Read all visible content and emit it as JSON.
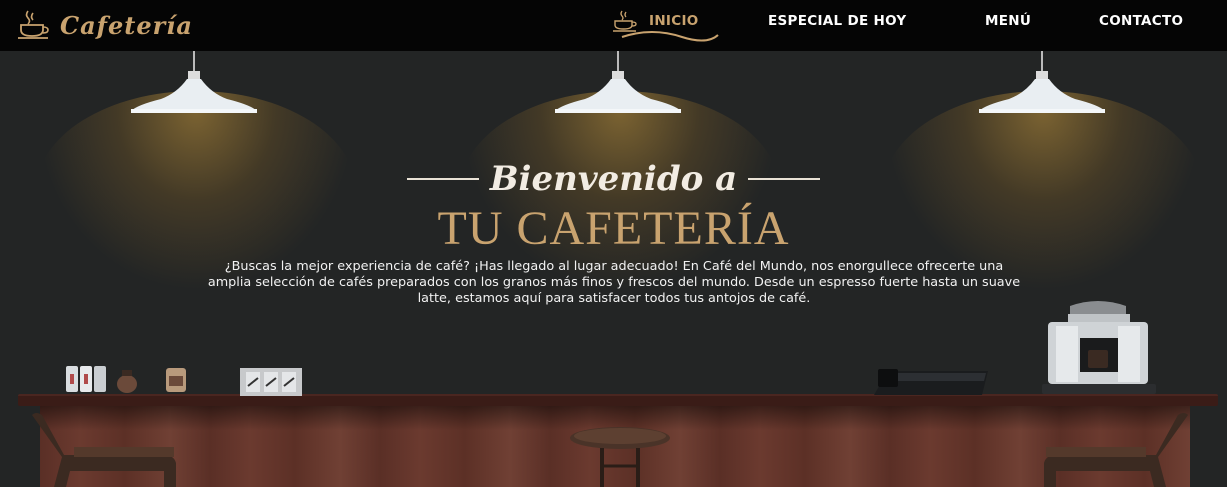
{
  "brand": {
    "name": "Cafetería",
    "icon": "coffee-cup-icon"
  },
  "nav": {
    "items": [
      {
        "label": "INICIO",
        "icon": "coffee-cup-icon",
        "active": true
      },
      {
        "label": "ESPECIAL DE HOY",
        "active": false
      },
      {
        "label": "MENÚ",
        "active": false
      },
      {
        "label": "CONTACTO",
        "active": false
      }
    ]
  },
  "hero": {
    "welcome": "Bienvenido a",
    "title": "TU CAFETERÍA",
    "description": "¿Buscas la mejor experiencia de café? ¡Has llegado al lugar adecuado! En Café del Mundo, nos enorgullece ofrecerte una amplia selección de cafés preparados con los granos más finos y frescos del mundo. Desde un espresso fuerte hasta un suave latte, estamos aquí para satisfacer todos tus antojos de café."
  },
  "colors": {
    "accent": "#c9a36f",
    "nav_bg": "#050505",
    "hero_bg": "#232525",
    "counter": "#5a2f26"
  }
}
